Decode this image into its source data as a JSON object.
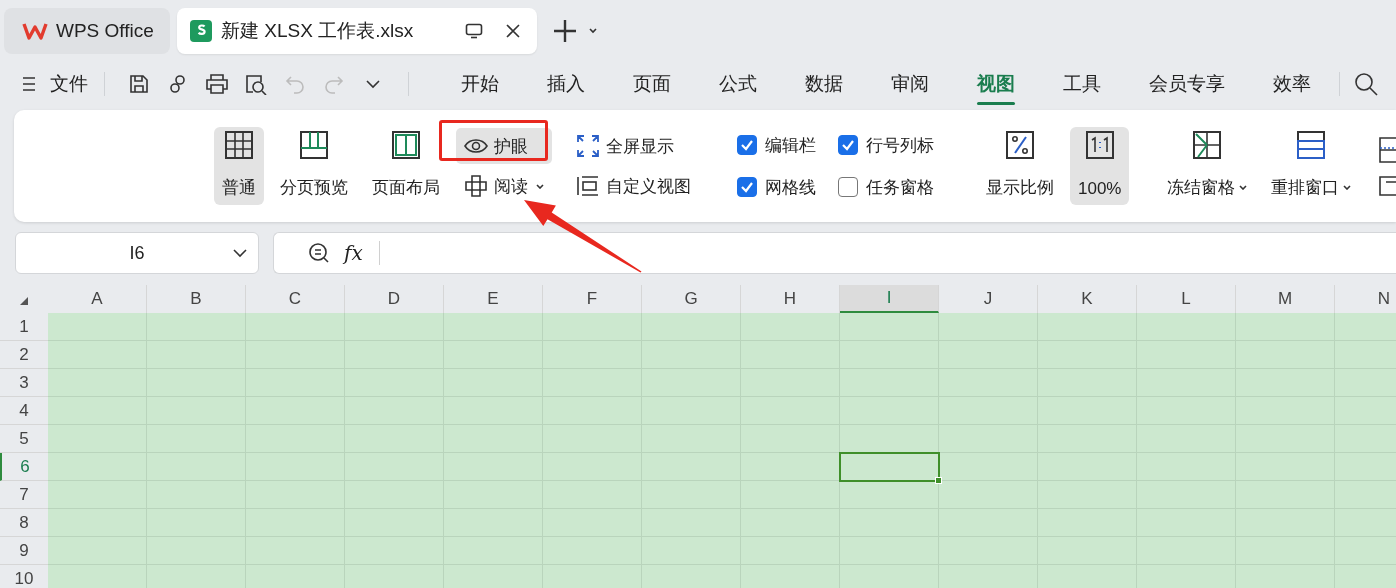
{
  "app_tabs": [
    {
      "kind": "home",
      "label": "WPS Office",
      "selected": false
    },
    {
      "kind": "document",
      "label": "新建 XLSX 工作表.xlsx",
      "selected": true
    }
  ],
  "toolbar": {
    "file_menu": "文件",
    "quick_access": [
      {
        "kind": "save",
        "disabled": false
      },
      {
        "kind": "format",
        "disabled": false
      },
      {
        "kind": "print",
        "disabled": false
      },
      {
        "kind": "preview",
        "disabled": false
      },
      {
        "kind": "undo",
        "disabled": true
      },
      {
        "kind": "redo",
        "disabled": true
      },
      {
        "kind": "more",
        "disabled": false
      }
    ]
  },
  "ribbon_tabs": [
    {
      "label": "开始",
      "selected": false
    },
    {
      "label": "插入",
      "selected": false
    },
    {
      "label": "页面",
      "selected": false
    },
    {
      "label": "公式",
      "selected": false
    },
    {
      "label": "数据",
      "selected": false
    },
    {
      "label": "审阅",
      "selected": false
    },
    {
      "label": "视图",
      "selected": true
    },
    {
      "label": "工具",
      "selected": false
    },
    {
      "label": "会员专享",
      "selected": false
    },
    {
      "label": "效率",
      "selected": false
    }
  ],
  "ribbon": [
    {
      "kind": "large",
      "label": "普通",
      "selected": true,
      "dropdown": false
    },
    {
      "kind": "large",
      "label": "分页预览",
      "selected": false,
      "dropdown": false
    },
    {
      "kind": "large",
      "label": "页面布局",
      "selected": false,
      "dropdown": false
    },
    {
      "kind": "stack",
      "items": [
        {
          "kind": "button",
          "label": "护眼",
          "selected": true,
          "dropdown": false
        },
        {
          "kind": "button",
          "label": "阅读",
          "selected": false,
          "dropdown": true
        }
      ]
    },
    {
      "kind": "stack",
      "items": [
        {
          "kind": "button",
          "label": "全屏显示",
          "selected": false,
          "dropdown": false
        },
        {
          "kind": "button",
          "label": "自定义视图",
          "selected": false,
          "dropdown": false
        }
      ]
    },
    {
      "kind": "divider"
    },
    {
      "kind": "stack",
      "items": [
        {
          "kind": "checkbox",
          "label": "编辑栏",
          "checked": true
        },
        {
          "kind": "checkbox",
          "label": "网格线",
          "checked": true
        }
      ]
    },
    {
      "kind": "stack",
      "items": [
        {
          "kind": "checkbox",
          "label": "行号列标",
          "checked": true
        },
        {
          "kind": "checkbox",
          "label": "任务窗格",
          "checked": false
        }
      ]
    },
    {
      "kind": "divider"
    },
    {
      "kind": "large",
      "label": "显示比例",
      "selected": false,
      "dropdown": false
    },
    {
      "kind": "large",
      "label": "100%",
      "selected": true,
      "dropdown": false
    },
    {
      "kind": "divider"
    },
    {
      "kind": "large",
      "label": "冻结窗格",
      "selected": false,
      "dropdown": true
    },
    {
      "kind": "large",
      "label": "重排窗口",
      "selected": false,
      "dropdown": true
    },
    {
      "kind": "partial"
    }
  ],
  "formula_bar": {
    "name_box": "I6",
    "function_label": "fx"
  },
  "sheet": {
    "eye_protection": true,
    "columns": [
      {
        "label": "A",
        "selected": false
      },
      {
        "label": "B",
        "selected": false
      },
      {
        "label": "C",
        "selected": false
      },
      {
        "label": "D",
        "selected": false
      },
      {
        "label": "E",
        "selected": false
      },
      {
        "label": "F",
        "selected": false
      },
      {
        "label": "G",
        "selected": false
      },
      {
        "label": "H",
        "selected": false
      },
      {
        "label": "I",
        "selected": true
      },
      {
        "label": "J",
        "selected": false
      },
      {
        "label": "K",
        "selected": false
      },
      {
        "label": "L",
        "selected": false
      },
      {
        "label": "M",
        "selected": false
      },
      {
        "label": "N",
        "selected": false
      }
    ],
    "rows": [
      {
        "label": "1",
        "selected": false
      },
      {
        "label": "2",
        "selected": false
      },
      {
        "label": "3",
        "selected": false
      },
      {
        "label": "4",
        "selected": false
      },
      {
        "label": "5",
        "selected": false
      },
      {
        "label": "6",
        "selected": true
      },
      {
        "label": "7",
        "selected": false
      },
      {
        "label": "8",
        "selected": false
      },
      {
        "label": "9",
        "selected": false
      },
      {
        "label": "10",
        "selected": false
      }
    ]
  },
  "annotation": {
    "highlight_box": true,
    "arrow": true
  }
}
